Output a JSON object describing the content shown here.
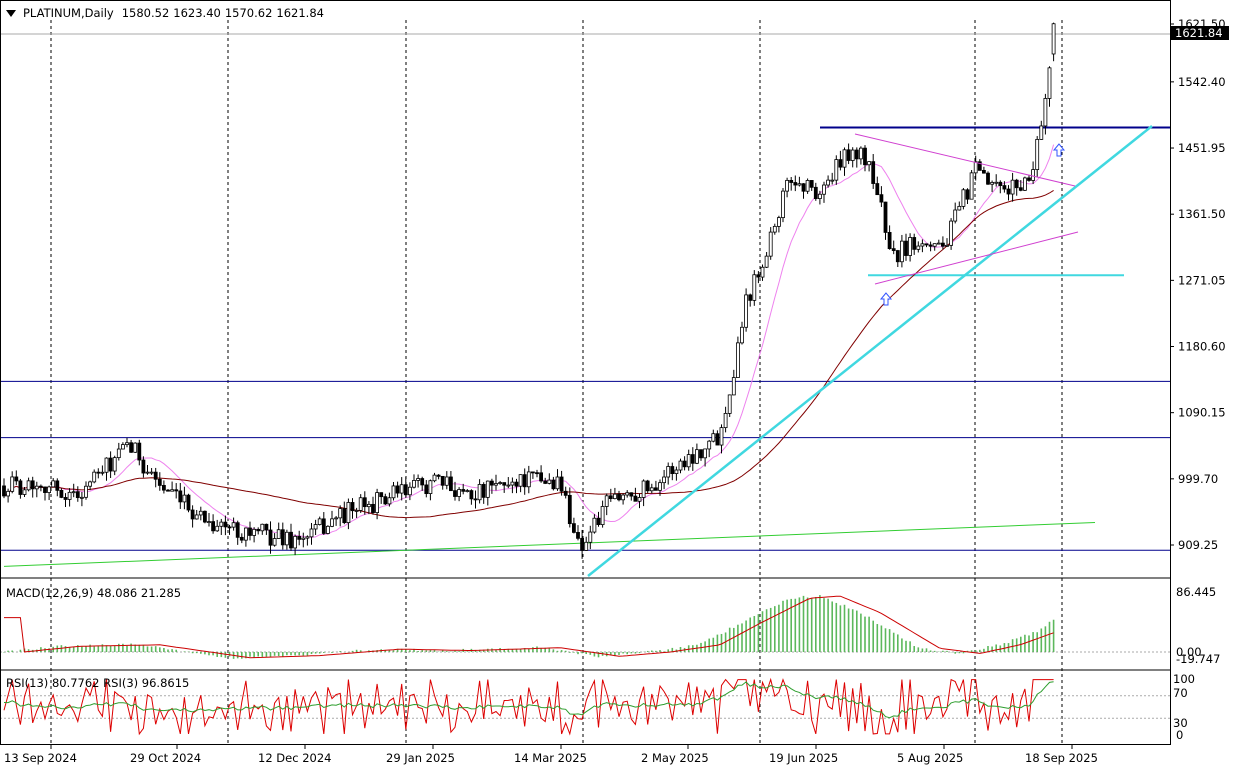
{
  "header": {
    "symbol": "PLATINUM,Daily",
    "open": "1580.52",
    "high": "1623.40",
    "low": "1570.62",
    "close": "1621.84"
  },
  "colors": {
    "candle": "#000000",
    "ma_fast": "#ee82ee",
    "ma_mid": "#800000",
    "ma_slow": "#32cd32",
    "trendline": "#40d8e0",
    "hline": "#00008b",
    "triangle": "#d040d0",
    "macd_hist": "#5cb85c",
    "macd_signal": "#cc0000",
    "rsi13": "#2e9e2e",
    "rsi3": "#dd0000",
    "arrow": "#3355ff",
    "level_line": "#00008b"
  },
  "price_axis": {
    "labels": [
      "1621.50",
      "1542.40",
      "1451.95",
      "1361.50",
      "1271.05",
      "1180.60",
      "1090.15",
      "999.70",
      "909.25"
    ],
    "current_price": "1621.84"
  },
  "macd": {
    "label": "MACD(12,26,9) 48.086 21.285",
    "axis_labels": [
      "86.445",
      "0.00",
      "-19.747"
    ]
  },
  "rsi": {
    "label": "RSI(13) 80.7762  RSI(3) 96.8615",
    "axis_labels": [
      "100",
      "70",
      "30",
      "0"
    ]
  },
  "date_axis": [
    "13 Sep 2024",
    "29 Oct 2024",
    "12 Dec 2024",
    "29 Jan 2025",
    "14 Mar 2025",
    "2 May 2025",
    "19 Jun 2025",
    "5 Aug 2025",
    "18 Sep 2025"
  ],
  "chart_data": {
    "type": "candlestick",
    "symbol": "PLATINUM",
    "timeframe": "Daily",
    "ylim": [
      870,
      1650
    ],
    "horizontal_levels": [
      1480,
      1280,
      1133,
      1056,
      902
    ],
    "series": [
      {
        "name": "close",
        "x": [
          "13 Sep 2024",
          "29 Oct 2024",
          "12 Dec 2024",
          "29 Jan 2025",
          "14 Mar 2025",
          "2 May 2025",
          "19 Jun 2025",
          "5 Aug 2025",
          "18 Sep 2025"
        ],
        "values": [
          990,
          995,
          935,
          975,
          960,
          975,
          1400,
          1330,
          1600
        ]
      }
    ],
    "macd": {
      "ylim": [
        -19.747,
        86.445
      ],
      "value": 48.086,
      "signal": 21.285
    },
    "rsi": {
      "ylim": [
        0,
        100
      ],
      "rsi13": 80.7762,
      "rsi3": 96.8615
    }
  }
}
